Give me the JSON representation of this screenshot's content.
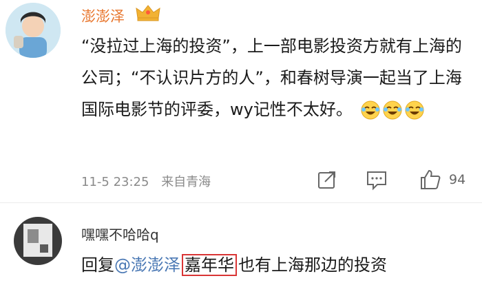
{
  "comments": [
    {
      "username": "澎澎泽",
      "text_parts": [
        "“没拉过上海的投资”，上一部电影投资方就有上海的公司；“不认识片方的人”，和春树导演一起当了上海国际电影节的评委，wy记性不太好。"
      ],
      "date": "11-5 23:25",
      "source": "来自青海",
      "likes": "94",
      "colors": {
        "username": "#e8772e",
        "text": "#1a1a1a"
      },
      "icons": [
        "crown-badge-icon",
        "laugh-cry-emoji-icon",
        "share-icon",
        "comment-icon",
        "like-icon"
      ]
    },
    {
      "username": "嘿嘿不哈哈q",
      "reply_prefix": "回复",
      "mention": "@澎澎泽",
      "highlighted": "嘉年华",
      "reply_tail": "也有上海那边的投资",
      "colors": {
        "mention": "#4a78b4",
        "highlight_border": "#d93434"
      }
    }
  ]
}
